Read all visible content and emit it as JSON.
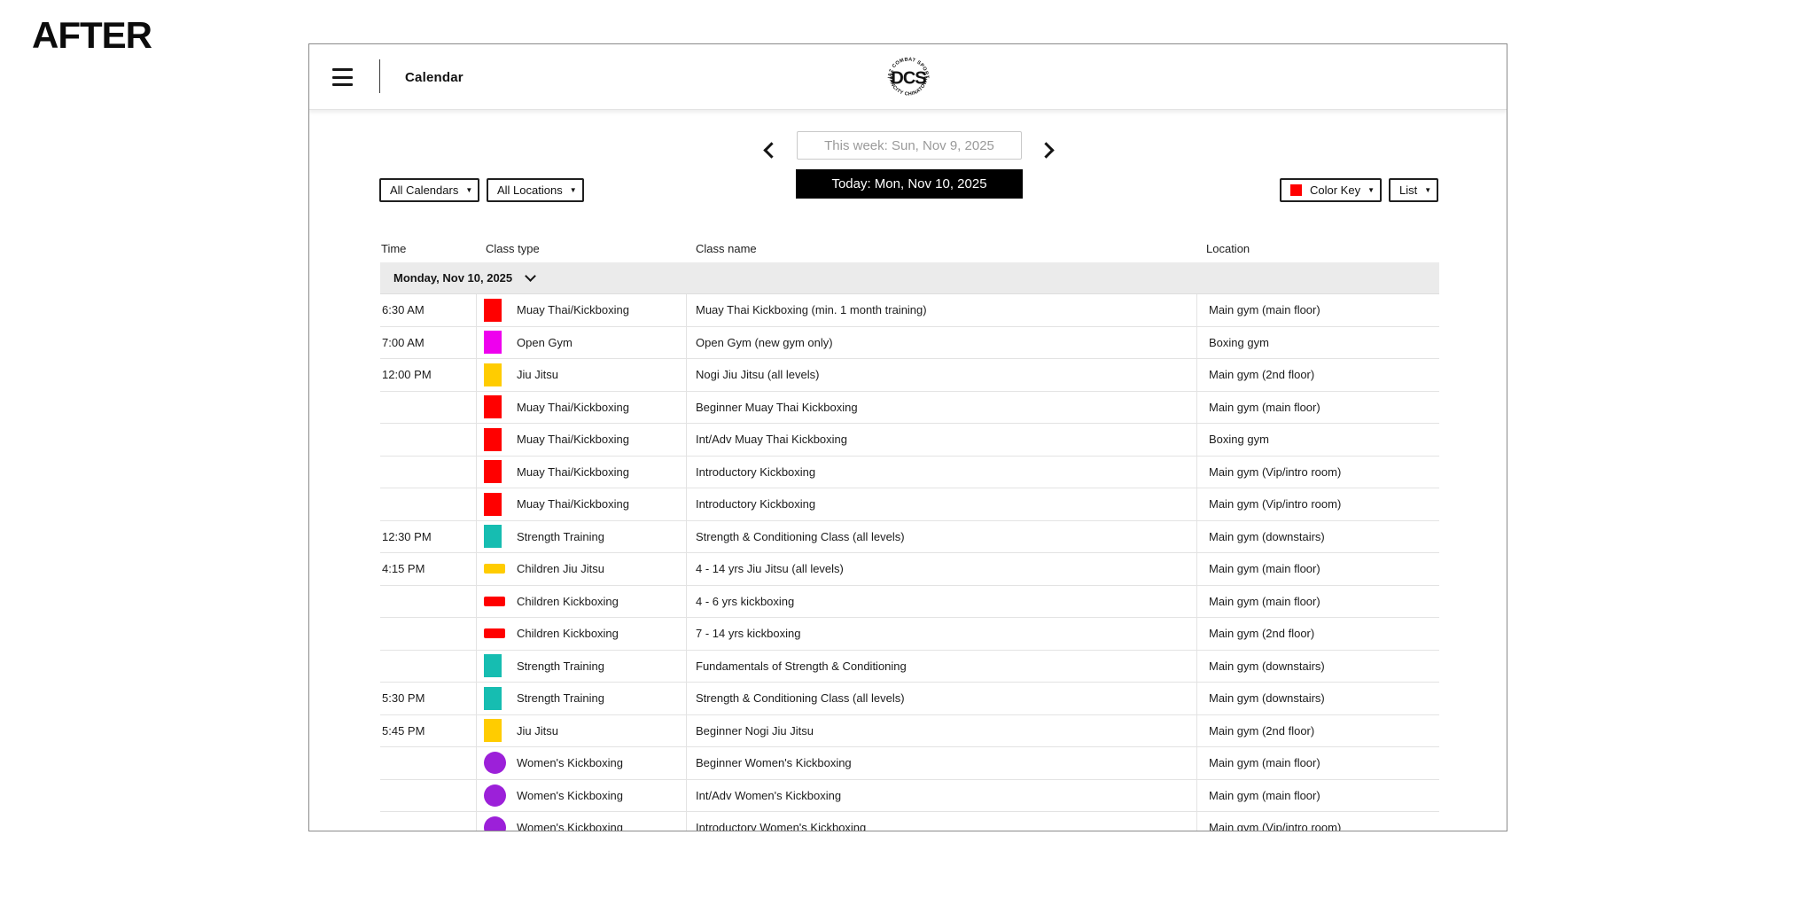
{
  "page": {
    "annotation": "AFTER"
  },
  "header": {
    "title": "Calendar",
    "logo": {
      "arc_top": "DIAZ COMBAT SPORTS",
      "center": "DCS",
      "arc_bottom": "VANCITY CHINATOWN"
    }
  },
  "week_nav": {
    "this_week": "This week: Sun, Nov 9, 2025",
    "today": "Today: Mon, Nov 10, 2025"
  },
  "filters": {
    "calendars_label": "All Calendars",
    "locations_label": "All Locations",
    "color_key_label": "Color Key",
    "color_key_swatch": "#ff0000",
    "view_label": "List"
  },
  "icons": {
    "caret_down": "▼"
  },
  "colors": {
    "red": "#ff0000",
    "magenta": "#ee00ee",
    "yellow": "#ffcc00",
    "teal": "#16bdb1",
    "purple": "#9c20d9"
  },
  "table": {
    "columns": [
      "Time",
      "Class type",
      "Class name",
      "Location"
    ],
    "day_header": "Monday, Nov 10, 2025",
    "rows": [
      {
        "time": "6:30 AM",
        "type": "Muay Thai/Kickboxing",
        "color": "#ff0000",
        "shape": "square",
        "name": "Muay Thai Kickboxing (min. 1 month training)",
        "location": "Main gym (main floor)"
      },
      {
        "time": "7:00 AM",
        "type": "Open Gym",
        "color": "#ee00ee",
        "shape": "square",
        "name": "Open Gym (new gym only)",
        "location": "Boxing gym"
      },
      {
        "time": "12:00 PM",
        "type": "Jiu Jitsu",
        "color": "#ffcc00",
        "shape": "square",
        "name": "Nogi Jiu Jitsu (all levels)",
        "location": "Main gym (2nd floor)"
      },
      {
        "time": "",
        "type": "Muay Thai/Kickboxing",
        "color": "#ff0000",
        "shape": "square",
        "name": "Beginner Muay Thai Kickboxing",
        "location": "Main gym (main floor)"
      },
      {
        "time": "",
        "type": "Muay Thai/Kickboxing",
        "color": "#ff0000",
        "shape": "square",
        "name": "Int/Adv Muay Thai Kickboxing",
        "location": "Boxing gym"
      },
      {
        "time": "",
        "type": "Muay Thai/Kickboxing",
        "color": "#ff0000",
        "shape": "square",
        "name": "Introductory Kickboxing",
        "location": "Main gym (Vip/intro room)"
      },
      {
        "time": "",
        "type": "Muay Thai/Kickboxing",
        "color": "#ff0000",
        "shape": "square",
        "name": "Introductory Kickboxing",
        "location": "Main gym (Vip/intro room)"
      },
      {
        "time": "12:30 PM",
        "type": "Strength Training",
        "color": "#16bdb1",
        "shape": "square",
        "name": "Strength & Conditioning Class (all levels)",
        "location": "Main gym (downstairs)"
      },
      {
        "time": "4:15 PM",
        "type": "Children Jiu Jitsu",
        "color": "#ffcc00",
        "shape": "bar",
        "name": "4 - 14 yrs Jiu Jitsu (all levels)",
        "location": "Main gym (main floor)"
      },
      {
        "time": "",
        "type": "Children Kickboxing",
        "color": "#ff0000",
        "shape": "bar",
        "name": "4 - 6 yrs kickboxing",
        "location": "Main gym (main floor)"
      },
      {
        "time": "",
        "type": "Children Kickboxing",
        "color": "#ff0000",
        "shape": "bar",
        "name": "7 - 14 yrs kickboxing",
        "location": "Main gym (2nd floor)"
      },
      {
        "time": "",
        "type": "Strength Training",
        "color": "#16bdb1",
        "shape": "square",
        "name": "Fundamentals of Strength & Conditioning",
        "location": "Main gym (downstairs)"
      },
      {
        "time": "5:30 PM",
        "type": "Strength Training",
        "color": "#16bdb1",
        "shape": "square",
        "name": "Strength & Conditioning Class (all levels)",
        "location": "Main gym (downstairs)"
      },
      {
        "time": "5:45 PM",
        "type": "Jiu Jitsu",
        "color": "#ffcc00",
        "shape": "square",
        "name": "Beginner Nogi Jiu Jitsu",
        "location": "Main gym (2nd floor)"
      },
      {
        "time": "",
        "type": "Women's Kickboxing",
        "color": "#9c20d9",
        "shape": "circle",
        "name": "Beginner Women's Kickboxing",
        "location": "Main gym (main floor)"
      },
      {
        "time": "",
        "type": "Women's Kickboxing",
        "color": "#9c20d9",
        "shape": "circle",
        "name": "Int/Adv Women's Kickboxing",
        "location": "Main gym (main floor)"
      },
      {
        "time": "",
        "type": "Women's Kickboxing",
        "color": "#9c20d9",
        "shape": "circle",
        "name": "Introductory Women's Kickboxing",
        "location": "Main gym (Vip/intro room)"
      }
    ]
  }
}
